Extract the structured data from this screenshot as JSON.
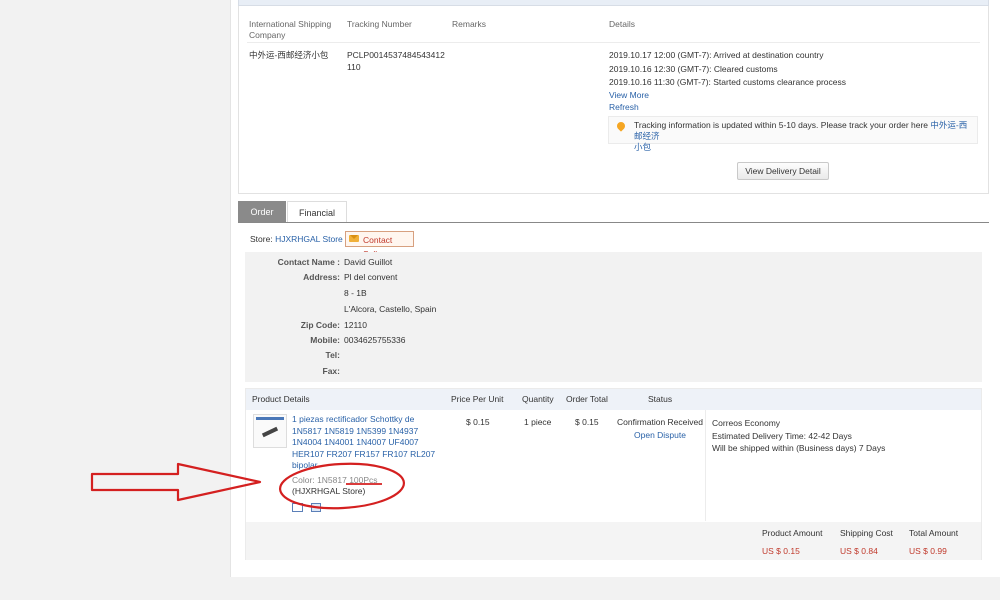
{
  "shipping": {
    "headers": {
      "company": "International Shipping Company",
      "tracking": "Tracking Number",
      "remarks": "Remarks",
      "details": "Details"
    },
    "company": "中外运-西邮经济小包",
    "tracking_number_line1": "PCLP0014537484543412",
    "tracking_number_line2": "110",
    "details": [
      "2019.10.17 12:00 (GMT-7): Arrived at destination country",
      "2019.10.16 12:30 (GMT-7): Cleared customs",
      "2019.10.16 11:30 (GMT-7): Started customs clearance process"
    ],
    "view_more": "View More",
    "refresh": "Refresh",
    "notice_text": "Tracking information is updated within 5-10 days. Please track your order here ",
    "notice_link_line1": "中外运-西邮经济",
    "notice_link_line2": "小包",
    "view_delivery_button": "View Delivery Detail",
    "pin_icon": "location-pin-icon"
  },
  "tabs": {
    "order": "Order",
    "financial": "Financial"
  },
  "store": {
    "label": "Store:",
    "name": "HJXRHGAL Store",
    "contact_seller": "Contact Seller",
    "mail_icon": "mail-icon"
  },
  "address": {
    "contact_name_label": "Contact Name :",
    "contact_name": "David Guillot",
    "address_label": "Address:",
    "address_line1": "Pl del convent",
    "address_line2": "8 - 1B",
    "address_line3": "L'Alcora, Castello, Spain",
    "zip_label": "Zip Code:",
    "zip": "12110",
    "mobile_label": "Mobile:",
    "mobile": "0034625755336",
    "tel_label": "Tel:",
    "fax_label": "Fax:"
  },
  "product": {
    "headers": {
      "details": "Product Details",
      "price": "Price Per Unit",
      "quantity": "Quantity",
      "order_total": "Order Total",
      "status": "Status"
    },
    "title_lines": [
      "1 piezas rectificador Schottky de",
      "1N5817 1N5819 1N5399 1N4937",
      "1N4004 1N4001 1N4007 UF4007",
      "HER107 FR207 FR157 FR107 RL207",
      "bipolar"
    ],
    "color_label": "Color:",
    "color_value": "1N5817 100Pcs",
    "store_tag": "(HJXRHGAL Store)",
    "price": "$ 0.15",
    "quantity": "1 piece",
    "order_total": "$ 0.15",
    "status": "Confirmation Received",
    "open_dispute": "Open Dispute",
    "shipping_method": "Correos Economy",
    "estimated_delivery": "Estimated Delivery Time: 42-42 Days",
    "ship_within": "Will be shipped within (Business days) 7 Days"
  },
  "totals": {
    "product_amount_label": "Product Amount",
    "shipping_cost_label": "Shipping Cost",
    "total_amount_label": "Total Amount",
    "product_amount": "US $ 0.15",
    "shipping_cost": "US $ 0.84",
    "total_amount": "US $ 0.99"
  },
  "colors": {
    "link": "#2a62a8",
    "price_red": "#c0392b",
    "annotation_red": "#d42020"
  }
}
